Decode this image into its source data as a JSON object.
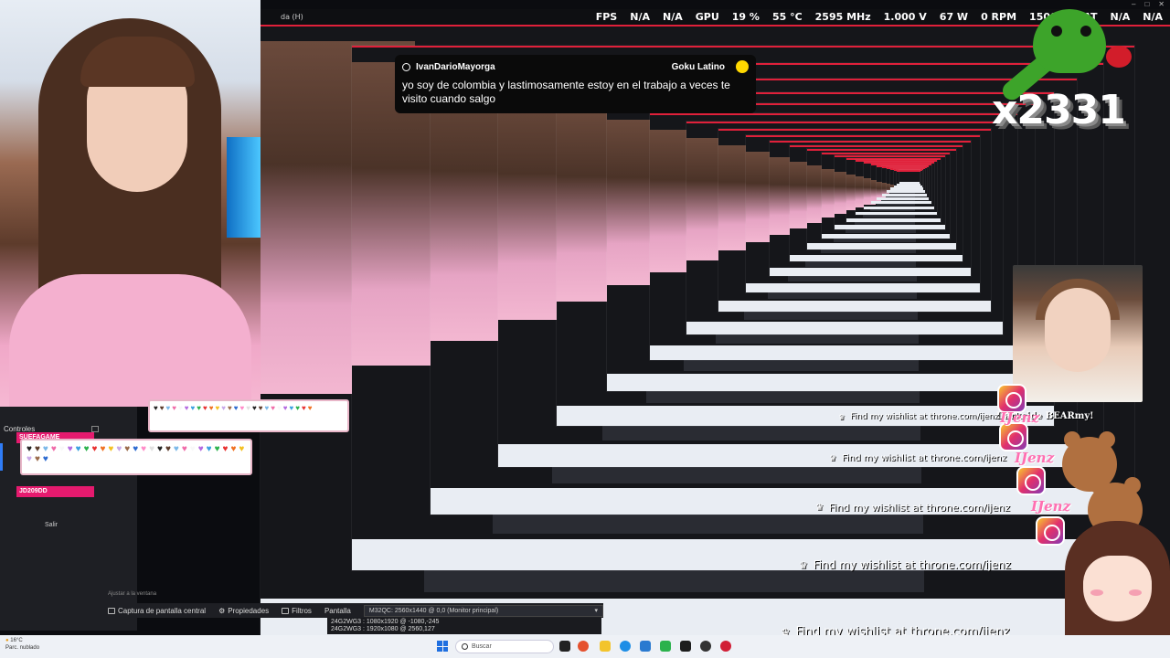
{
  "hud": {
    "window_title": "da (H)",
    "fps_label": "FPS",
    "fps_value1": "N/A",
    "fps_value2": "N/A",
    "gpu_label": "GPU",
    "gpu_usage": "19 %",
    "gpu_temp": "55 °C",
    "gpu_clock": "2595 MHz",
    "gpu_volt": "1.000 V",
    "gpu_power": "67 W",
    "gpu_fan": "0 RPM",
    "gpu_mem": "15001",
    "lat_label": "LAT",
    "lat_value1": "N/A",
    "lat_value2": "N/A"
  },
  "chat": {
    "username": "IvanDarioMayorga",
    "channel": "Goku Latino",
    "message": "yo soy de colombia y lastimosamente estoy en el trabajo a veces te visito cuando salgo"
  },
  "overlays": {
    "counter": "x2331",
    "darkside": "Darkside BEARmy!",
    "ijenz": "IJenz",
    "wishlist": "Find my wishlist at throne.com/ijenz"
  },
  "obs": {
    "controls_label": "Controles",
    "tab1": "SUEFAGAME",
    "tab2": "JD209DD",
    "exit_label": "Salir",
    "adjust_label": "Ajustar a la ventana",
    "source_label": "Captura de pantalla central",
    "properties_label": "Propiedades",
    "filters_label": "Filtros",
    "screen_label": "Pantalla",
    "screen_value": "M32QC: 2560x1440 @ 0,0 (Monitor principal)",
    "dropdown_options": [
      "24G2WG3 : 1080x1920 @ -1080,-245",
      "24G2WG3 : 1920x1080 @ 2560,127"
    ]
  },
  "taskbar": {
    "weather_temp": "16°C",
    "weather_desc": "Parc. nublado",
    "search_placeholder": "Buscar"
  },
  "colors": {
    "accent_red": "#e0203a",
    "pink_tab": "#e51a6e",
    "taskbar_bg": "#eef1f6"
  }
}
